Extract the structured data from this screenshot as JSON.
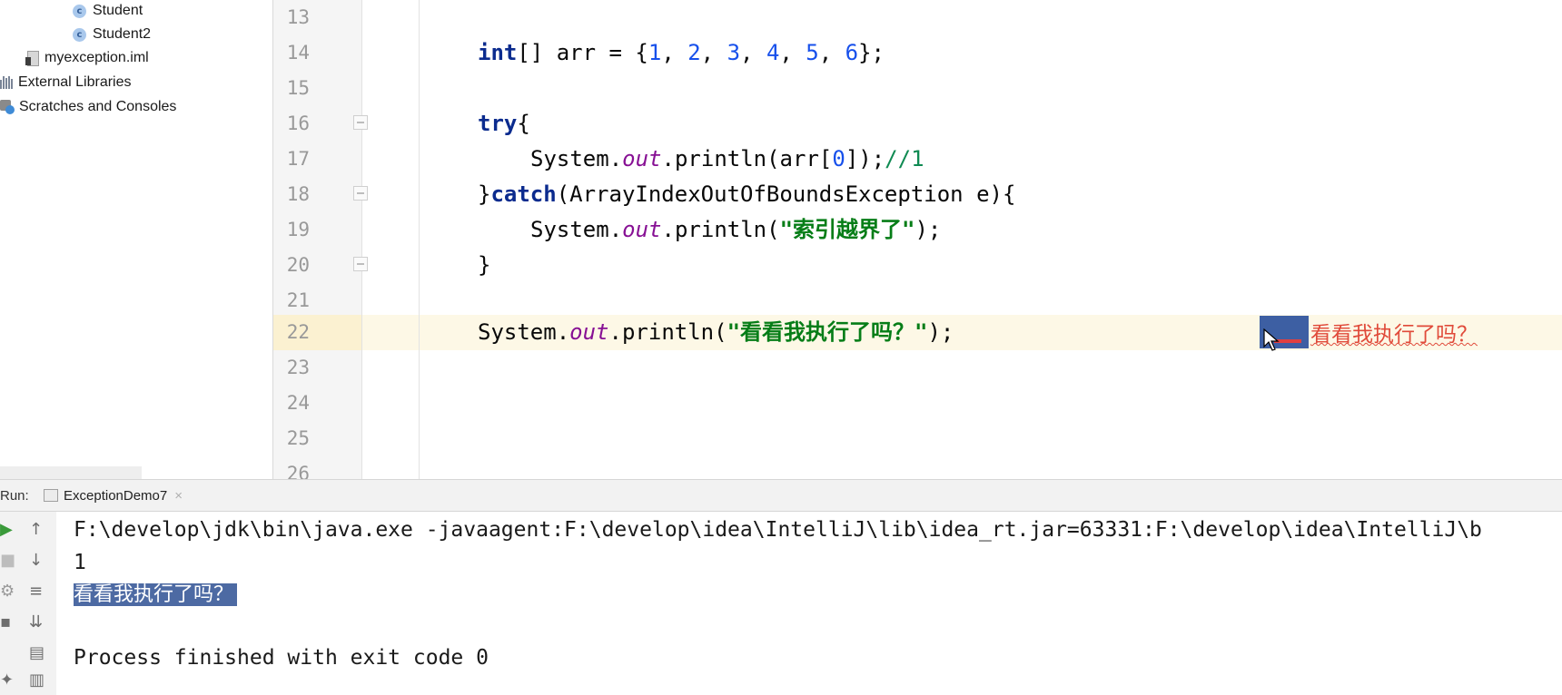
{
  "project_tree": {
    "items": [
      {
        "label": "Student",
        "icon": "class-icon"
      },
      {
        "label": "Student2",
        "icon": "class-icon"
      },
      {
        "label": "myexception.iml",
        "icon": "iml-file-icon"
      },
      {
        "label": "External Libraries",
        "icon": "libraries-icon"
      },
      {
        "label": "Scratches and Consoles",
        "icon": "scratches-icon"
      }
    ]
  },
  "editor": {
    "line_numbers": [
      "13",
      "14",
      "15",
      "16",
      "17",
      "18",
      "19",
      "20",
      "21",
      "22",
      "23",
      "24",
      "25",
      "26"
    ],
    "current_line": "22",
    "lines": {
      "l14": {
        "kw": "int",
        "a": "[] arr = {",
        "n1": "1",
        "c1": ", ",
        "n2": "2",
        "c2": ", ",
        "n3": "3",
        "c3": ", ",
        "n4": "4",
        "c4": ", ",
        "n5": "5",
        "c5": ", ",
        "n6": "6",
        "end": "};"
      },
      "l16": {
        "kw": "try",
        "end": "{"
      },
      "l17": {
        "a": "System.",
        "fld": "out",
        "b": ".println(arr[",
        "n": "0",
        "c": "]);",
        "cmt": "//1"
      },
      "l18": {
        "a": "}",
        "kw": "catch",
        "b": "(ArrayIndexOutOfBoundsException e){"
      },
      "l19": {
        "a": "System.",
        "fld": "out",
        "b": ".println(",
        "str": "\"索引越界了\"",
        "c": ");"
      },
      "l20": {
        "a": "}"
      },
      "l22": {
        "a": "System.",
        "fld": "out",
        "b": ".println(",
        "str": "\"看看我执行了吗？\"",
        "c": ");"
      }
    },
    "inline_hint": "看看我执行了吗？"
  },
  "run_panel": {
    "label": "Run:",
    "tab_title": "ExceptionDemo7",
    "console_lines": [
      "F:\\develop\\jdk\\bin\\java.exe -javaagent:F:\\develop\\idea\\IntelliJ\\lib\\idea_rt.jar=63331:F:\\develop\\idea\\IntelliJ\\b",
      "1",
      "看看我执行了吗？",
      "Process finished with exit code 0"
    ]
  },
  "colors": {
    "keyword": "#0b2b8e",
    "number": "#1750eb",
    "field": "#871094",
    "string": "#067d17",
    "selection": "#4d6aa3",
    "current_line": "#fdf8e6"
  }
}
